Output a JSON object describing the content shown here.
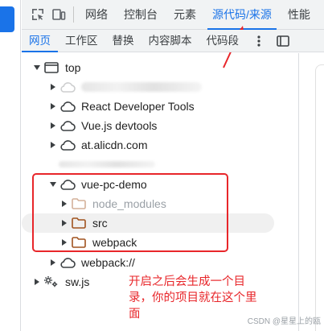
{
  "main_tabs": [
    "网络",
    "控制台",
    "元素",
    "源代码/来源",
    "性能"
  ],
  "active_main_tab": "源代码/来源",
  "sub_tabs": [
    "网页",
    "工作区",
    "替换",
    "内容脚本",
    "代码段"
  ],
  "active_sub_tab": "网页",
  "tree": {
    "top": "top",
    "react_tools": "React Developer Tools",
    "vue_tools": "Vue.js devtools",
    "cdn": "at.alicdn.com",
    "vue_demo": "vue-pc-demo",
    "node_modules": "node_modules",
    "src": "src",
    "webpack": "webpack",
    "webpack_root": "webpack://",
    "sw": "sw.js"
  },
  "annotation": {
    "line1": "开启之后会生成一个目",
    "line2": "录，你的项目就在这个里",
    "line3": "面"
  },
  "watermark": "CSDN @星星上的瓯",
  "colors": {
    "accent": "#1a73e8",
    "annotation_red": "#e8262a",
    "folder_brown": "#a0521e"
  }
}
